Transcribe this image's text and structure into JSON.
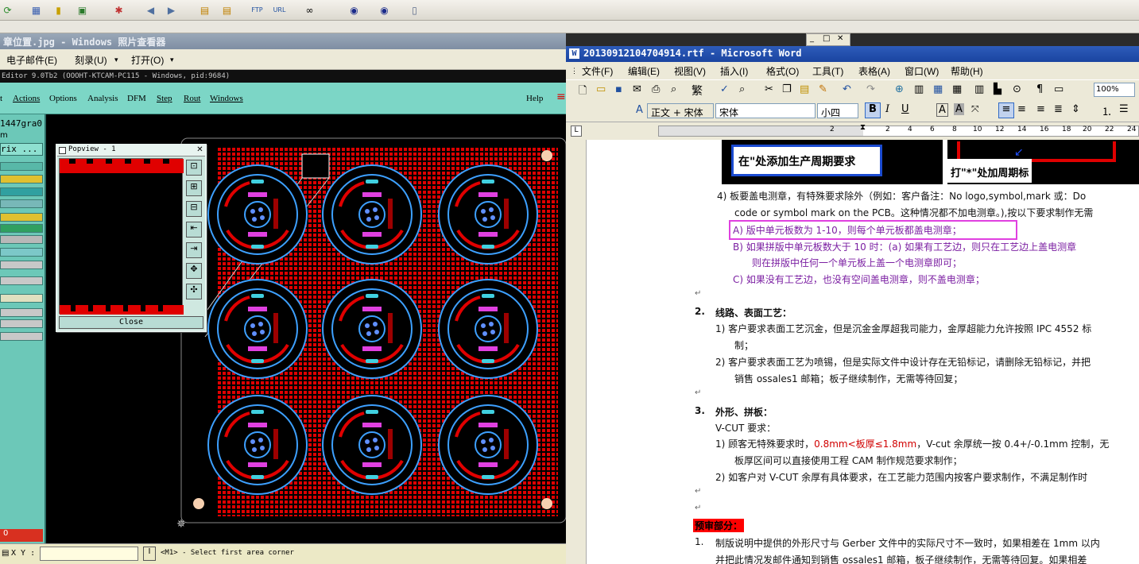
{
  "photo_viewer": {
    "title": "章位置.jpg - Windows 照片查看器",
    "menu": [
      "电子邮件(E)",
      "刻录(U)",
      "▾",
      "打开(O)",
      "▾"
    ]
  },
  "cam": {
    "title": "Editor 9.0Tb2 (OOOHT-KTCAM-PC115 - Windows, pid:9684)",
    "menu": [
      "t",
      "Actions",
      "Options",
      "Analysis",
      "DFM",
      "Step",
      "Rout",
      "Windows"
    ],
    "help": "Help",
    "job_name": "1447gra0",
    "left_label_1": "m",
    "matrix_label": "rix ...",
    "bottom_zero": "0",
    "xy_label": "X Y :",
    "status_text": "<M1> - Select first area corner"
  },
  "popview": {
    "title": "Popview - 1",
    "close_label": "Close"
  },
  "word": {
    "title": "20130912104704914.rtf - Microsoft Word",
    "menu": [
      "文件(F)",
      "编辑(E)",
      "视图(V)",
      "插入(I)",
      "格式(O)",
      "工具(T)",
      "表格(A)",
      "窗口(W)",
      "帮助(H)"
    ],
    "zoom": "100%",
    "style": "正文 + 宋体",
    "font": "宋体",
    "size": "小四",
    "ruler_numbers": [
      "2",
      "2",
      "4",
      "6",
      "8",
      "10",
      "12",
      "14",
      "16",
      "18",
      "20",
      "22",
      "24"
    ],
    "image_caption_left": "在\"处添加生产周期要求",
    "image_caption_right": "打\"*\"处加周期标",
    "lines": {
      "l1": "4) 板要盖电测章，有特殊要求除外（例如：客户备注：No logo,symbol,mark 或：Do",
      "l2": "code or symbol mark on the PCB。这种情况都不加电测章。),按以下要求制作无需",
      "a": "A) 版中单元板数为 1-10，则每个单元板都盖电测章；",
      "b1": "B) 如果拼版中单元板数大于 10 时：(a) 如果有工艺边，则只在工艺边上盖电测章",
      "b2": "则在拼版中任何一个单元板上盖一个电测章即可；",
      "c": "C) 如果没有工艺边，也没有空间盖电测章，则不盖电测章；",
      "h2num": "2.",
      "h2": "线路、表面工艺：",
      "p21": "1) 客户要求表面工艺沉金，但是沉金金厚超我司能力，金厚超能力允许按照 IPC 4552 标",
      "p21b": "制；",
      "p22": "2) 客户要求表面工艺为喷锡，但是实际文件中设计存在无铅标记，请删除无铅标记，并把",
      "p22b": "销售 ossales1 邮箱；板子继续制作，无需等待回复；",
      "h3num": "3.",
      "h3": "外形、拼板：",
      "vcut": "V-CUT 要求：",
      "p31a": "1) 顾客无特殊要求时，",
      "p31red": "0.8mm<板厚≤1.8mm",
      "p31b": "，V-cut 余厚统一按 0.4+/-0.1mm 控制，无",
      "p31c": "板厚区间可以直接使用工程 CAM 制作规范要求制作；",
      "p32": "2) 如客户对 V-CUT 余厚有具体要求，在工艺能力范围内按客户要求制作，不满足制作时",
      "pre": "预审部分：",
      "n1num": "1.",
      "n1": "制版说明中提供的外形尺寸与 Gerber 文件中的实际尺寸不一致时，如果相差在 1mm 以内",
      "n1b": "并把此情况发邮件通知到销售 ossales1 邮箱，板子继续制作，无需等待回复。如果相差"
    }
  },
  "colors": {
    "cam_menu": "#7cd6c6",
    "board_red": "#e00000",
    "circle_blue": "#3da0ff",
    "highlight_box": "#e040e0",
    "word_title": "#1a44a0"
  }
}
